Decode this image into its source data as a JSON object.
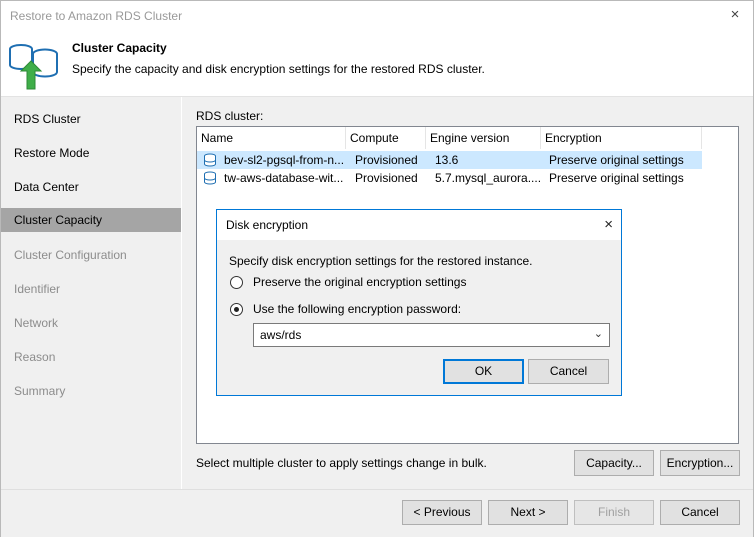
{
  "window": {
    "title": "Restore to Amazon RDS Cluster",
    "close_icon": "×"
  },
  "header": {
    "title": "Cluster Capacity",
    "subtitle": "Specify the capacity and disk encryption settings for the restored RDS cluster."
  },
  "sidebar": {
    "items": [
      {
        "label": "RDS Cluster",
        "state": "done"
      },
      {
        "label": "Restore Mode",
        "state": "done"
      },
      {
        "label": "Data Center",
        "state": "done"
      },
      {
        "label": "Cluster Capacity",
        "state": "active"
      },
      {
        "label": "Cluster Configuration",
        "state": "pending"
      },
      {
        "label": "Identifier",
        "state": "pending"
      },
      {
        "label": "Network",
        "state": "pending"
      },
      {
        "label": "Reason",
        "state": "pending"
      },
      {
        "label": "Summary",
        "state": "pending"
      }
    ]
  },
  "main": {
    "rds_label": "RDS cluster:",
    "columns": [
      "Name",
      "Compute",
      "Engine version",
      "Encryption"
    ],
    "rows": [
      {
        "name": "bev-sl2-pgsql-from-n...",
        "compute": "Provisioned",
        "engine": "13.6",
        "encryption": "Preserve original settings",
        "selected": true
      },
      {
        "name": "tw-aws-database-wit...",
        "compute": "Provisioned",
        "engine": "5.7.mysql_aurora....",
        "encryption": "Preserve original settings",
        "selected": false
      }
    ],
    "bulk_hint": "Select multiple cluster to apply settings change in bulk.",
    "capacity_button": "Capacity...",
    "encryption_button": "Encryption..."
  },
  "dialog": {
    "title": "Disk encryption",
    "close_icon": "×",
    "description": "Specify disk encryption settings for the restored instance.",
    "option_preserve": "Preserve the original encryption settings",
    "option_password": "Use the following encryption password:",
    "selected_option": "password",
    "combo_value": "aws/rds",
    "ok_label": "OK",
    "cancel_label": "Cancel"
  },
  "footer": {
    "previous": "< Previous",
    "next": "Next >",
    "finish": "Finish",
    "cancel": "Cancel"
  },
  "colors": {
    "accent": "#0078d7",
    "selection": "#cce8ff",
    "active_step": "#a5a5a5"
  }
}
